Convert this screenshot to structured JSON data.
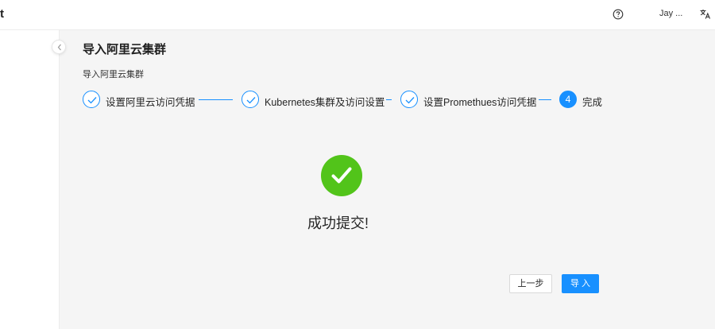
{
  "header": {
    "brand": "t",
    "user_name": "Jay ...",
    "icons": {
      "help": "help-circle-icon",
      "language": "translate-icon"
    }
  },
  "page": {
    "title": "导入阿里云集群",
    "breadcrumb": "导入阿里云集群"
  },
  "steps": [
    {
      "label": "设置阿里云访问凭据",
      "status": "done"
    },
    {
      "label": "Kubernetes集群及访问设置",
      "status": "done"
    },
    {
      "label": "设置Promethues访问凭据",
      "status": "done"
    },
    {
      "label": "完成",
      "number": "4",
      "status": "active"
    }
  ],
  "result": {
    "message": "成功提交!"
  },
  "actions": {
    "prev_label": "上一步",
    "import_label": "导 入"
  },
  "colors": {
    "primary": "#1890ff",
    "success": "#52c41a",
    "background": "#f5f5f5"
  }
}
